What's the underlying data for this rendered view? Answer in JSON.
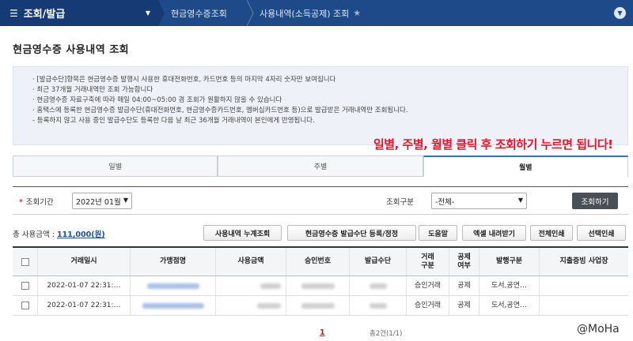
{
  "header": {
    "menu_label": "조회/발급",
    "breadcrumbs": [
      "현금영수증조회",
      "사용내역(소득공제) 조회"
    ]
  },
  "page_title": "현금영수증 사용내역 조회",
  "notice_lines": [
    "· [발급수단]항목은 현금영수증 발행시 사용한 휴대전화번호, 카드번호 등의 마지막 4자리 숫자만 보여집니다",
    "· 최근 37개월 거래내역만 조회 가능합니다",
    "· 현금영수증 자료구축에 따라 매일 04:00~05:00 경 조회가 원활하지 않을 수 있습니다",
    "· 홈택스에 등록한 현금영수증 발급수단(휴대전화번호, 현금영수증카드번호, 멤버십카드번호 등)으로 발급받은 거래내역만 조회됩니다.",
    "- 등록하지 않고 사용 중인 발급수단도 등록한 다음 날 최근 36개월 거래내역이 본인에게 반영됩니다."
  ],
  "annotation": "일별, 주별, 월별 클릭 후 조회하기 누르면 됩니다!",
  "tabs": [
    "일별",
    "주별",
    "월별"
  ],
  "search": {
    "period_label": "조회기간",
    "period_value": "2022년 01월",
    "kind_label": "조회구분",
    "kind_value": "-전체-",
    "search_button": "조회하기"
  },
  "total": {
    "label": "총 사용금액 :",
    "value": "111,000(원)"
  },
  "toolbar": {
    "cumulative": "사용내역 누계조회",
    "register": "현금영수증 발급수단 등록/정정",
    "help": "도움말",
    "excel": "엑셀 내려받기",
    "print_all": "전체인쇄",
    "print_selected": "선택인쇄"
  },
  "table": {
    "columns": [
      "거래일시",
      "가맹점명",
      "사용금액",
      "승인번호",
      "발급수단",
      "거래\n구분",
      "공제\n여부",
      "발행구분",
      "지출증빙 사업장"
    ],
    "rows": [
      {
        "datetime": "2022-01-07 22:31:…",
        "type": "승인거래",
        "deduct": "공제",
        "issue": "도서,공연…"
      },
      {
        "datetime": "2022-01-07 22:31:…",
        "type": "승인거래",
        "deduct": "공제",
        "issue": "도서,공연…"
      }
    ]
  },
  "pagination": {
    "current": "1",
    "count": "총2건(1/1)"
  },
  "watermark": "@MoHa"
}
